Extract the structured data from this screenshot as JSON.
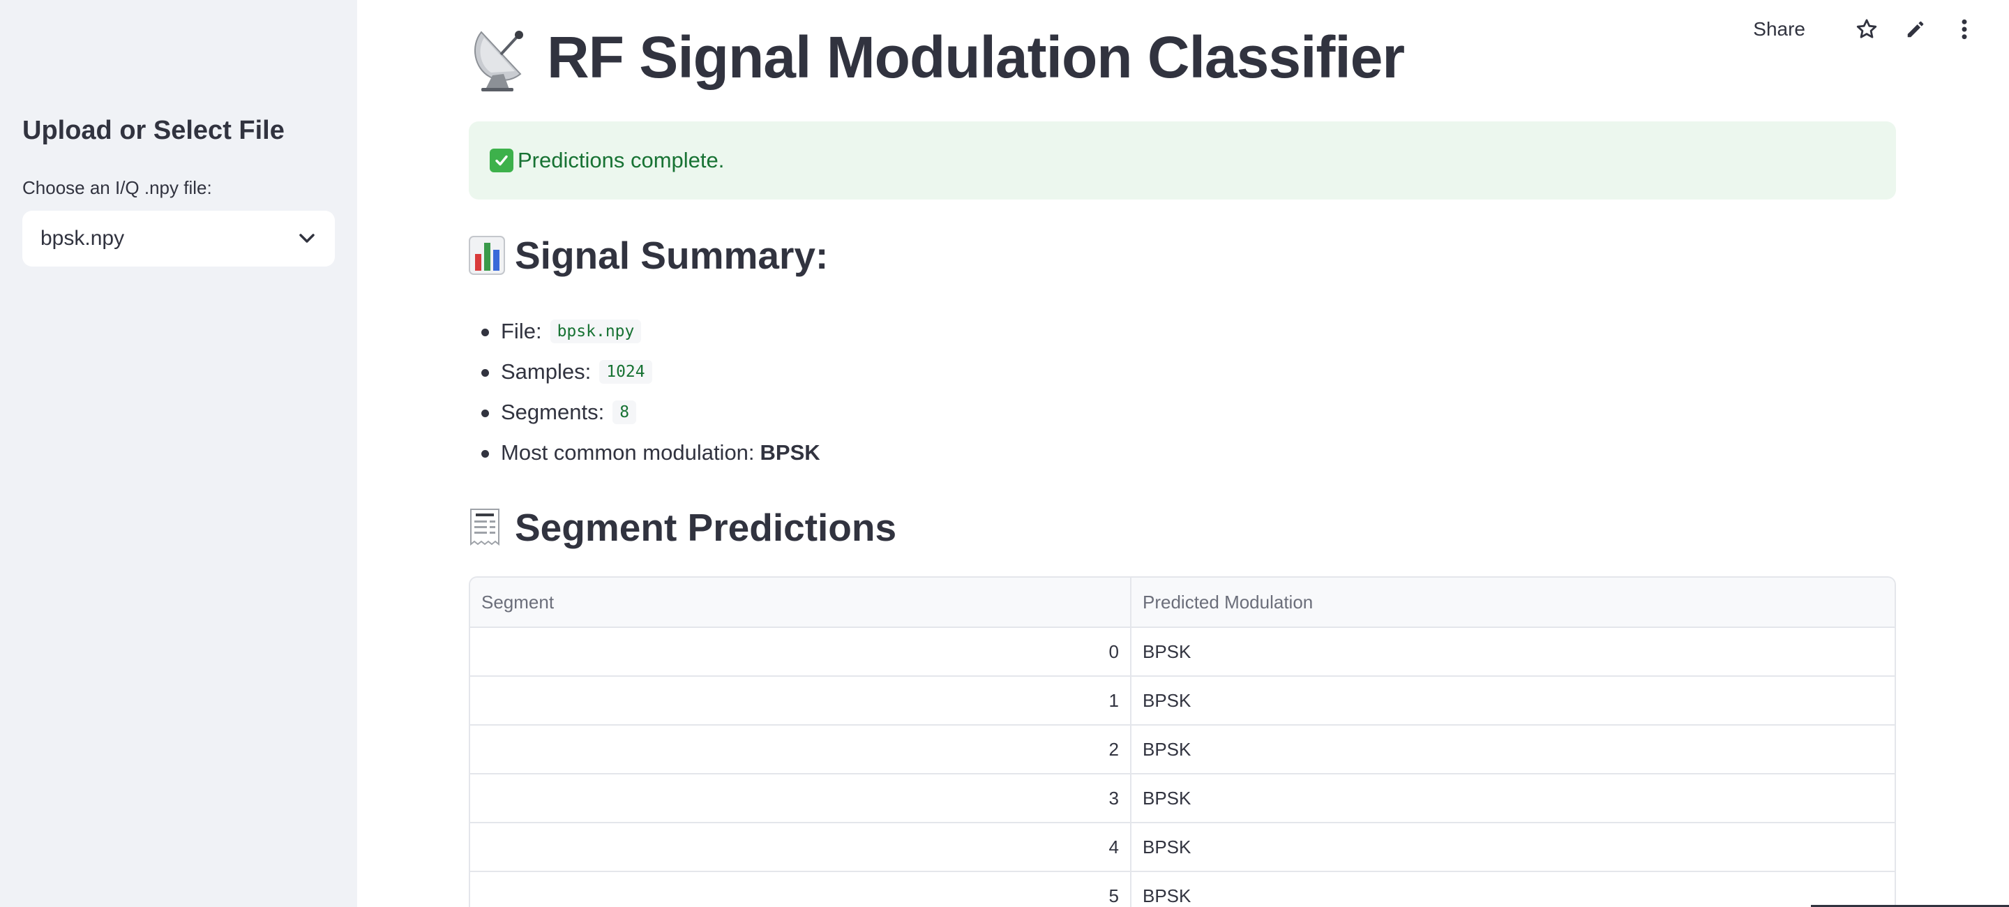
{
  "sidebar": {
    "title": "Upload or Select File",
    "select_label": "Choose an I/Q .npy file:",
    "select_value": "bpsk.npy"
  },
  "toolbar": {
    "share_label": "Share"
  },
  "page": {
    "title": "RF Signal Modulation Classifier"
  },
  "alert": {
    "text": "Predictions complete."
  },
  "summary": {
    "heading": "Signal Summary:",
    "file_label": "File:",
    "file_value": "bpsk.npy",
    "samples_label": "Samples:",
    "samples_value": "1024",
    "segments_label": "Segments:",
    "segments_value": "8",
    "common_label": "Most common modulation:",
    "common_value": "BPSK"
  },
  "predictions": {
    "heading": "Segment Predictions",
    "columns": [
      "Segment",
      "Predicted Modulation"
    ],
    "rows": [
      [
        "0",
        "BPSK"
      ],
      [
        "1",
        "BPSK"
      ],
      [
        "2",
        "BPSK"
      ],
      [
        "3",
        "BPSK"
      ],
      [
        "4",
        "BPSK"
      ],
      [
        "5",
        "BPSK"
      ]
    ]
  },
  "icons": {
    "title": "satellite-antenna-icon",
    "alert": "check-mark-icon",
    "summary": "bar-chart-icon",
    "predictions": "receipt-icon",
    "select": "chevron-down-icon",
    "toolbar": [
      "star-icon",
      "edit-pencil-icon",
      "more-vertical-icon"
    ]
  },
  "colors": {
    "sidebar_bg": "#f0f2f6",
    "alert_bg": "#ecf7ee",
    "alert_text": "#177233",
    "code_text": "#177233",
    "text": "#31333f"
  }
}
